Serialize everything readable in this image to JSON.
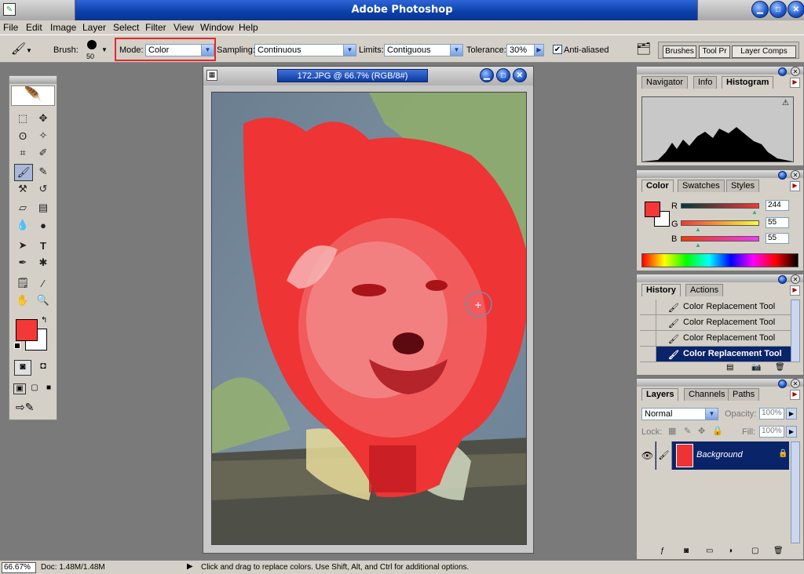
{
  "app_title": "Adobe Photoshop",
  "menu": [
    "File",
    "Edit",
    "Image",
    "Layer",
    "Select",
    "Filter",
    "View",
    "Window",
    "Help"
  ],
  "options": {
    "brush_label": "Brush:",
    "brush_size": "50",
    "mode_label": "Mode:",
    "mode_value": "Color",
    "sampling_label": "Sampling:",
    "sampling_value": "Continuous",
    "limits_label": "Limits:",
    "limits_value": "Contiguous",
    "tolerance_label": "Tolerance:",
    "tolerance_value": "30%",
    "antialias_label": "Anti-aliased",
    "palette_tabs": [
      "Brushes",
      "Tool Pr",
      "Layer Comps"
    ]
  },
  "document": {
    "title": "172.JPG @ 66.7% (RGB/8#)"
  },
  "navigator_panel": {
    "tabs": [
      "Navigator",
      "Info",
      "Histogram"
    ],
    "active_tab": "Histogram"
  },
  "color_panel": {
    "tabs": [
      "Color",
      "Swatches",
      "Styles"
    ],
    "r_label": "R",
    "r_value": "244",
    "g_label": "G",
    "g_value": "55",
    "b_label": "B",
    "b_value": "55",
    "foreground": "#f43737"
  },
  "history_panel": {
    "tabs": [
      "History",
      "Actions"
    ],
    "items": [
      "Color Replacement Tool",
      "Color Replacement Tool",
      "Color Replacement Tool",
      "Color Replacement Tool"
    ]
  },
  "layers_panel": {
    "tabs": [
      "Layers",
      "Channels",
      "Paths"
    ],
    "blend_mode": "Normal",
    "opacity_label": "Opacity:",
    "opacity_value": "100%",
    "lock_label": "Lock:",
    "fill_label": "Fill:",
    "fill_value": "100%",
    "layer_name": "Background"
  },
  "status": {
    "zoom": "66.67%",
    "doc_info": "Doc: 1.48M/1.48M",
    "hint": "Click and drag to replace colors. Use Shift, Alt, and Ctrl for additional options."
  },
  "colors": {
    "accent": "#0a246a",
    "highlight": "#e8262b"
  }
}
